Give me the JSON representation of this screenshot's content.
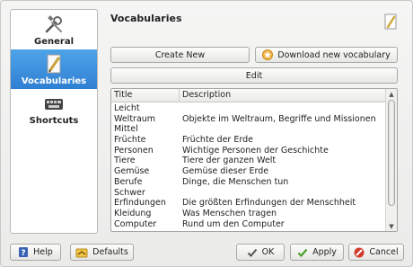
{
  "sidebar": {
    "items": [
      {
        "label": "General",
        "icon": "tools-icon"
      },
      {
        "label": "Vocabularies",
        "icon": "document-pencil-icon",
        "active": true
      },
      {
        "label": "Shortcuts",
        "icon": "keyboard-icon"
      }
    ]
  },
  "header": {
    "title": "Vocabularies"
  },
  "toolbar": {
    "create_new": "Create New",
    "download": "Download new vocabulary",
    "edit": "Edit"
  },
  "table": {
    "columns": [
      "Title",
      "Description"
    ],
    "rows": [
      {
        "title": "Leicht",
        "description": ""
      },
      {
        "title": "Weltraum",
        "description": "Objekte im Weltraum, Begriffe und Missionen"
      },
      {
        "title": "Mittel",
        "description": ""
      },
      {
        "title": "Früchte",
        "description": "Früchte der Erde"
      },
      {
        "title": "Personen",
        "description": "Wichtige Personen der Geschichte"
      },
      {
        "title": "Tiere",
        "description": "Tiere der ganzen Welt"
      },
      {
        "title": "Gemüse",
        "description": "Gemüse dieser Erde"
      },
      {
        "title": "Berufe",
        "description": "Dinge, die Menschen tun"
      },
      {
        "title": "Schwer",
        "description": ""
      },
      {
        "title": "Erfindungen",
        "description": "Die größten Erfindungen der Menschheit"
      },
      {
        "title": "Kleidung",
        "description": "Was Menschen tragen"
      },
      {
        "title": "Computer",
        "description": "Rund um den Computer"
      }
    ]
  },
  "footer": {
    "help": "Help",
    "defaults": "Defaults",
    "ok": "OK",
    "apply": "Apply",
    "cancel": "Cancel"
  },
  "colors": {
    "selection": "#3b8ddc",
    "cancel_red": "#d23a2a",
    "apply_green": "#4aa02c",
    "help_blue": "#3a63b8"
  }
}
